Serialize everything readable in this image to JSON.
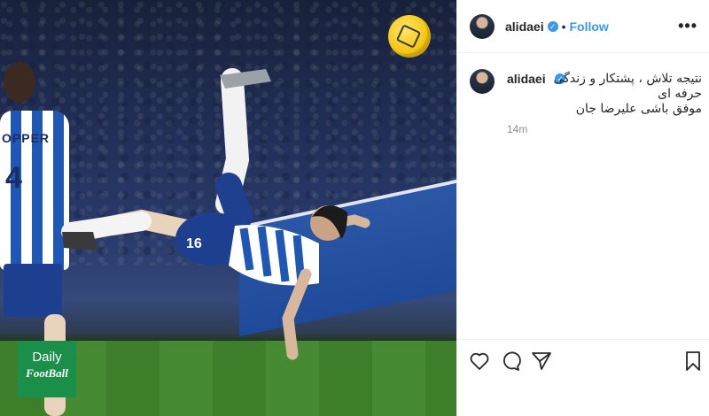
{
  "post": {
    "username": "alidaei",
    "separator": "•",
    "follow_label": "Follow",
    "more_label": "•••"
  },
  "photo": {
    "player_name_print": "OPPER",
    "player_number": "4",
    "shorts_number": "16"
  },
  "logo": {
    "line1": "Daily",
    "line2": "FootBall"
  },
  "comment": {
    "username": "alidaei",
    "text_line1": "نتیجه تلاش ، پشتکار و زندگی",
    "text_line2": "حرفه ای",
    "text_line3": "موفق باشی علیرضا جان",
    "time": "14m"
  },
  "colors": {
    "verified": "#3897f0",
    "follow": "#3897f0",
    "logo_bg": "#1a8f4a"
  },
  "icons": [
    "heart-icon",
    "comment-icon",
    "share-icon",
    "bookmark-icon",
    "verified-icon",
    "more-icon"
  ]
}
